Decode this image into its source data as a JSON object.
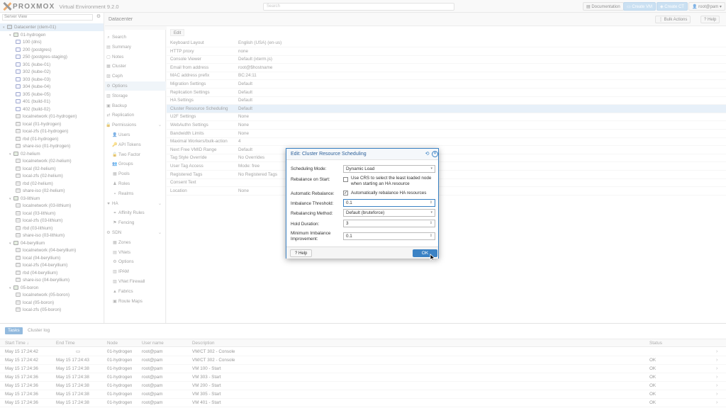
{
  "app": {
    "logo_text": "PROXMOX",
    "product": "Virtual Environment 9.2.0",
    "search_placeholder": "Search",
    "btn_documentation": "Documentation",
    "btn_create_vm": "Create VM",
    "btn_create_ct": "Create CT",
    "user_menu": "root@pam"
  },
  "tree": {
    "view": "Server View",
    "rows": [
      {
        "label": "Datacenter (clem-01)",
        "type": "dc",
        "indent": 0,
        "toggle": "▾",
        "selected": true
      },
      {
        "label": "01-hydrogen",
        "type": "node",
        "indent": 1,
        "toggle": "▾"
      },
      {
        "label": "100 (dns)",
        "type": "vm",
        "indent": 2
      },
      {
        "label": "200 (postgres)",
        "type": "vm",
        "indent": 2
      },
      {
        "label": "250 (postgres-staging)",
        "type": "vm",
        "indent": 2
      },
      {
        "label": "301 (kube-01)",
        "type": "vm",
        "indent": 2
      },
      {
        "label": "302 (kube-02)",
        "type": "vm",
        "indent": 2
      },
      {
        "label": "303 (kube-03)",
        "type": "vm",
        "indent": 2
      },
      {
        "label": "304 (kube-04)",
        "type": "vm",
        "indent": 2
      },
      {
        "label": "305 (kube-05)",
        "type": "vm",
        "indent": 2
      },
      {
        "label": "401 (build-01)",
        "type": "vm",
        "indent": 2
      },
      {
        "label": "402 (build-02)",
        "type": "vm",
        "indent": 2
      },
      {
        "label": "localnetwork (01-hydrogen)",
        "type": "net",
        "indent": 2
      },
      {
        "label": "local (01-hydrogen)",
        "type": "st",
        "indent": 2
      },
      {
        "label": "local-zfs (01-hydrogen)",
        "type": "st",
        "indent": 2
      },
      {
        "label": "rbd (01-hydrogen)",
        "type": "st",
        "indent": 2
      },
      {
        "label": "share-iso (01-hydrogen)",
        "type": "st",
        "indent": 2
      },
      {
        "label": "02-helium",
        "type": "node",
        "indent": 1,
        "toggle": "▾"
      },
      {
        "label": "localnetwork (02-helium)",
        "type": "net",
        "indent": 2
      },
      {
        "label": "local (02-helium)",
        "type": "st",
        "indent": 2
      },
      {
        "label": "local-zfs (02-helium)",
        "type": "st",
        "indent": 2
      },
      {
        "label": "rbd (02-helium)",
        "type": "st",
        "indent": 2
      },
      {
        "label": "share-iso (02-helium)",
        "type": "st",
        "indent": 2
      },
      {
        "label": "03-lithium",
        "type": "node",
        "indent": 1,
        "toggle": "▾"
      },
      {
        "label": "localnetwork (03-lithium)",
        "type": "net",
        "indent": 2
      },
      {
        "label": "local (03-lithium)",
        "type": "st",
        "indent": 2
      },
      {
        "label": "local-zfs (03-lithium)",
        "type": "st",
        "indent": 2
      },
      {
        "label": "rbd (03-lithium)",
        "type": "st",
        "indent": 2
      },
      {
        "label": "share-iso (03-lithium)",
        "type": "st",
        "indent": 2
      },
      {
        "label": "04-beryllium",
        "type": "node",
        "indent": 1,
        "toggle": "▾"
      },
      {
        "label": "localnetwork (04-beryllium)",
        "type": "net",
        "indent": 2
      },
      {
        "label": "local (04-beryllium)",
        "type": "st",
        "indent": 2
      },
      {
        "label": "local-zfs (04-beryllium)",
        "type": "st",
        "indent": 2
      },
      {
        "label": "rbd (04-beryllium)",
        "type": "st",
        "indent": 2
      },
      {
        "label": "share-iso (04-beryllium)",
        "type": "st",
        "indent": 2
      },
      {
        "label": "05-boron",
        "type": "node",
        "indent": 1,
        "toggle": "▾"
      },
      {
        "label": "localnetwork (05-boron)",
        "type": "net",
        "indent": 2
      },
      {
        "label": "local (05-boron)",
        "type": "st",
        "indent": 2
      },
      {
        "label": "local-zfs (05-boron)",
        "type": "st",
        "indent": 2
      }
    ]
  },
  "main": {
    "title": "Datacenter",
    "bulk_actions": "Bulk Actions",
    "help": "Help",
    "edit": "Edit"
  },
  "menu": [
    {
      "icon": "⌕",
      "label": "Search",
      "sub": false
    },
    {
      "icon": "▤",
      "label": "Summary",
      "sub": false
    },
    {
      "icon": "▢",
      "label": "Notes",
      "sub": false
    },
    {
      "icon": "▦",
      "label": "Cluster",
      "sub": false
    },
    {
      "icon": "▨",
      "label": "Ceph",
      "sub": false
    },
    {
      "icon": "⚙",
      "label": "Options",
      "sub": false,
      "selected": true
    },
    {
      "icon": "▥",
      "label": "Storage",
      "sub": false
    },
    {
      "icon": "▣",
      "label": "Backup",
      "sub": false
    },
    {
      "icon": "⇄",
      "label": "Replication",
      "sub": false
    },
    {
      "icon": "🔒",
      "label": "Permissions",
      "sub": false,
      "group": true
    },
    {
      "icon": "👤",
      "label": "Users",
      "sub": true
    },
    {
      "icon": "🔑",
      "label": "API Tokens",
      "sub": true
    },
    {
      "icon": "🔓",
      "label": "Two Factor",
      "sub": true
    },
    {
      "icon": "👥",
      "label": "Groups",
      "sub": true
    },
    {
      "icon": "▦",
      "label": "Pools",
      "sub": true
    },
    {
      "icon": "♟",
      "label": "Roles",
      "sub": true
    },
    {
      "icon": "▪",
      "label": "Realms",
      "sub": true
    },
    {
      "icon": "♥",
      "label": "HA",
      "sub": false,
      "group": true
    },
    {
      "icon": "⚭",
      "label": "Affinity Rules",
      "sub": true
    },
    {
      "icon": "⚑",
      "label": "Fencing",
      "sub": true
    },
    {
      "icon": "⚙",
      "label": "SDN",
      "sub": false,
      "group": true
    },
    {
      "icon": "▦",
      "label": "Zones",
      "sub": true
    },
    {
      "icon": "▤",
      "label": "VNets",
      "sub": true
    },
    {
      "icon": "⚙",
      "label": "Options",
      "sub": true
    },
    {
      "icon": "▥",
      "label": "IPAM",
      "sub": true
    },
    {
      "icon": "▨",
      "label": "VNet Firewall",
      "sub": true
    },
    {
      "icon": "▲",
      "label": "Fabrics",
      "sub": true
    },
    {
      "icon": "▣",
      "label": "Route Maps",
      "sub": true
    }
  ],
  "options_grid": [
    {
      "key": "Keyboard Layout",
      "value": "English (USA) (en-us)"
    },
    {
      "key": "HTTP proxy",
      "value": "none"
    },
    {
      "key": "Console Viewer",
      "value": "Default (xterm.js)"
    },
    {
      "key": "Email from address",
      "value": "root@$hostname"
    },
    {
      "key": "MAC address prefix",
      "value": "BC:24:11"
    },
    {
      "key": "Migration Settings",
      "value": "Default"
    },
    {
      "key": "Replication Settings",
      "value": "Default"
    },
    {
      "key": "HA Settings",
      "value": "Default"
    },
    {
      "key": "Cluster Resource Scheduling",
      "value": "Default",
      "selected": true
    },
    {
      "key": "U2F Settings",
      "value": "None"
    },
    {
      "key": "WebAuthn Settings",
      "value": "None"
    },
    {
      "key": "Bandwidth Limits",
      "value": "None"
    },
    {
      "key": "Maximal Workers/bulk-action",
      "value": "4"
    },
    {
      "key": "Next Free VMID Range",
      "value": "Default"
    },
    {
      "key": "Tag Style Override",
      "value": "No Overrides"
    },
    {
      "key": "User Tag Access",
      "value": "Mode: free"
    },
    {
      "key": "Registered Tags",
      "value": "No Registered Tags"
    },
    {
      "key": "Consent Text",
      "value": ""
    },
    {
      "key": "Location",
      "value": "None"
    }
  ],
  "dialog": {
    "title": "Edit: Cluster Resource Scheduling",
    "scheduling_mode_label": "Scheduling Mode:",
    "scheduling_mode_value": "Dynamic Load",
    "rebalance_on_start_label": "Rebalance on Start:",
    "rebalance_on_start_text": "Use CRS to select the least loaded node when starting an HA resource",
    "automatic_rebalance_label": "Automatic Rebalance:",
    "automatic_rebalance_text": "Automatically rebalance HA resources",
    "imbalance_threshold_label": "Imbalance Threshold:",
    "imbalance_threshold_value": "0.1",
    "rebalancing_method_label": "Rebalancing Method:",
    "rebalancing_method_value": "Default (bruteforce)",
    "hold_duration_label": "Hold Duration:",
    "hold_duration_value": "3",
    "min_improvement_label": "Minimum Imbalance Improvement:",
    "min_improvement_value": "0.1",
    "help": "Help",
    "ok": "OK"
  },
  "bottom": {
    "tab_tasks": "Tasks",
    "tab_cluster_log": "Cluster log",
    "headers": {
      "start": "Start Time ↓",
      "end": "End Time",
      "node": "Node",
      "user": "User name",
      "desc": "Description",
      "status": "Status"
    },
    "rows": [
      {
        "start": "May 15 17:24:42",
        "end": "",
        "running": true,
        "node": "01-hydrogen",
        "user": "root@pam",
        "desc": "VM/CT 302 - Console",
        "status": ""
      },
      {
        "start": "May 15 17:24:42",
        "end": "May 15 17:24:43",
        "node": "01-hydrogen",
        "user": "root@pam",
        "desc": "VM/CT 302 - Console",
        "status": "OK"
      },
      {
        "start": "May 15 17:24:36",
        "end": "May 15 17:24:38",
        "node": "01-hydrogen",
        "user": "root@pam",
        "desc": "VM 100 - Start",
        "status": "OK"
      },
      {
        "start": "May 15 17:24:36",
        "end": "May 15 17:24:38",
        "node": "01-hydrogen",
        "user": "root@pam",
        "desc": "VM 303 - Start",
        "status": "OK"
      },
      {
        "start": "May 15 17:24:36",
        "end": "May 15 17:24:38",
        "node": "01-hydrogen",
        "user": "root@pam",
        "desc": "VM 200 - Start",
        "status": "OK"
      },
      {
        "start": "May 15 17:24:36",
        "end": "May 15 17:24:38",
        "node": "01-hydrogen",
        "user": "root@pam",
        "desc": "VM 305 - Start",
        "status": "OK"
      },
      {
        "start": "May 15 17:24:36",
        "end": "May 15 17:24:38",
        "node": "01-hydrogen",
        "user": "root@pam",
        "desc": "VM 401 - Start",
        "status": "OK"
      }
    ]
  },
  "colors": {
    "accent": "#3b82c4",
    "logo_orange": "#e57000",
    "selection": "#d3e4f5"
  }
}
